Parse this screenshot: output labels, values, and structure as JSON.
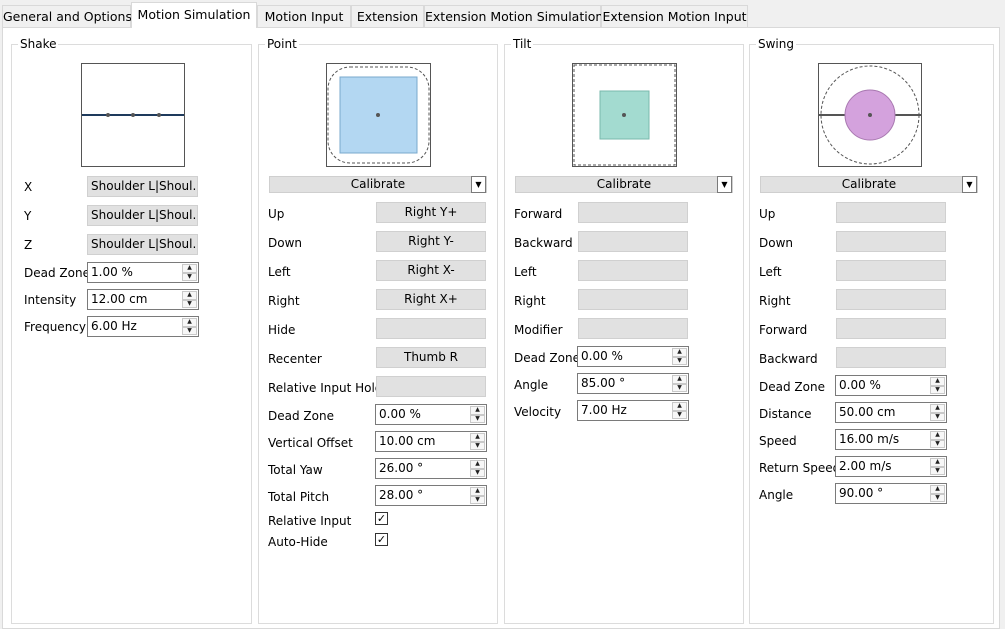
{
  "tabs": [
    "General and Options",
    "Motion Simulation",
    "Motion Input",
    "Extension",
    "Extension Motion Simulation",
    "Extension Motion Input"
  ],
  "active_tab": 1,
  "shake": {
    "title": "Shake",
    "rows": [
      {
        "label": "X",
        "button": "Shoulder L|Shoul..."
      },
      {
        "label": "Y",
        "button": "Shoulder L|Shoul..."
      },
      {
        "label": "Z",
        "button": "Shoulder L|Shoul..."
      }
    ],
    "spins": [
      {
        "label": "Dead Zone",
        "value": "1.00 %"
      },
      {
        "label": "Intensity",
        "value": "12.00 cm"
      },
      {
        "label": "Frequency",
        "value": "6.00 Hz"
      }
    ]
  },
  "point": {
    "title": "Point",
    "calibrate": "Calibrate",
    "buttons": [
      {
        "label": "Up",
        "value": "Right Y+"
      },
      {
        "label": "Down",
        "value": "Right Y-"
      },
      {
        "label": "Left",
        "value": "Right X-"
      },
      {
        "label": "Right",
        "value": "Right X+"
      },
      {
        "label": "Hide",
        "value": ""
      },
      {
        "label": "Recenter",
        "value": "Thumb R"
      },
      {
        "label": "Relative Input Hold",
        "value": ""
      }
    ],
    "spins": [
      {
        "label": "Dead Zone",
        "value": "0.00 %"
      },
      {
        "label": "Vertical Offset",
        "value": "10.00 cm"
      },
      {
        "label": "Total Yaw",
        "value": "26.00 °"
      },
      {
        "label": "Total Pitch",
        "value": "28.00 °"
      }
    ],
    "checks": [
      {
        "label": "Relative Input",
        "checked": true
      },
      {
        "label": "Auto-Hide",
        "checked": true
      }
    ]
  },
  "tilt": {
    "title": "Tilt",
    "calibrate": "Calibrate",
    "buttons": [
      {
        "label": "Forward",
        "value": ""
      },
      {
        "label": "Backward",
        "value": ""
      },
      {
        "label": "Left",
        "value": ""
      },
      {
        "label": "Right",
        "value": ""
      },
      {
        "label": "Modifier",
        "value": ""
      }
    ],
    "spins": [
      {
        "label": "Dead Zone",
        "value": "0.00 %"
      },
      {
        "label": "Angle",
        "value": "85.00 °"
      },
      {
        "label": "Velocity",
        "value": "7.00 Hz"
      }
    ]
  },
  "swing": {
    "title": "Swing",
    "calibrate": "Calibrate",
    "buttons": [
      {
        "label": "Up",
        "value": ""
      },
      {
        "label": "Down",
        "value": ""
      },
      {
        "label": "Left",
        "value": ""
      },
      {
        "label": "Right",
        "value": ""
      },
      {
        "label": "Forward",
        "value": ""
      },
      {
        "label": "Backward",
        "value": ""
      }
    ],
    "spins": [
      {
        "label": "Dead Zone",
        "value": "0.00 %"
      },
      {
        "label": "Distance",
        "value": "50.00 cm"
      },
      {
        "label": "Speed",
        "value": "16.00 m/s"
      },
      {
        "label": "Return Speed",
        "value": "2.00 m/s"
      },
      {
        "label": "Angle",
        "value": "90.00 °"
      }
    ]
  },
  "colors": {
    "point_fill": "#b3d7f2",
    "tilt_fill": "#a3dbd0",
    "swing_fill": "#d4a2dd",
    "shake_line": "#1e3a5c"
  }
}
